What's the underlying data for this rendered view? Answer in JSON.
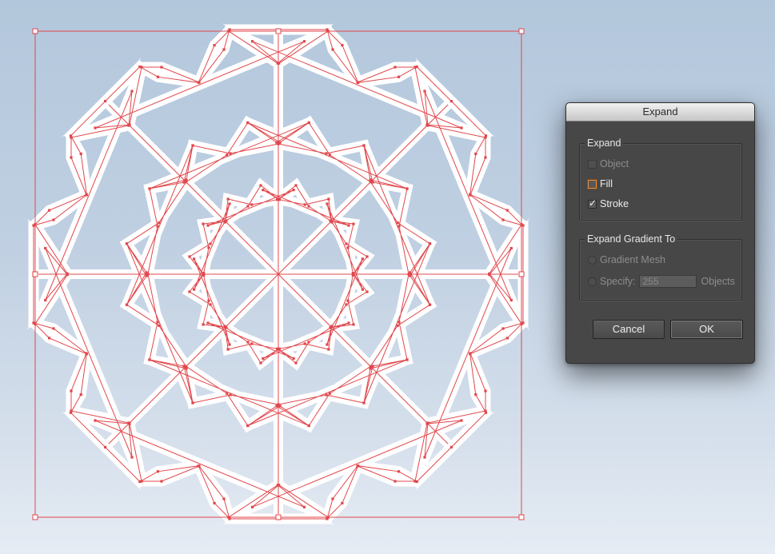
{
  "dialog": {
    "title": "Expand",
    "expand_group": {
      "title": "Expand",
      "object": {
        "label": "Object",
        "checked": false,
        "enabled": false
      },
      "fill": {
        "label": "Fill",
        "checked": false,
        "enabled": true
      },
      "stroke": {
        "label": "Stroke",
        "checked": true,
        "enabled": true
      }
    },
    "gradient_group": {
      "title": "Expand Gradient To",
      "gradient_mesh": {
        "label": "Gradient Mesh",
        "enabled": false
      },
      "specify": {
        "label": "Specify:",
        "value": "255",
        "suffix": "Objects",
        "enabled": false
      }
    },
    "buttons": {
      "cancel": "Cancel",
      "ok": "OK"
    }
  },
  "artwork": {
    "stroke_color": "#ffffff",
    "path_color": "#e0474c",
    "selection_color": "#e0474c",
    "arms": 8
  }
}
